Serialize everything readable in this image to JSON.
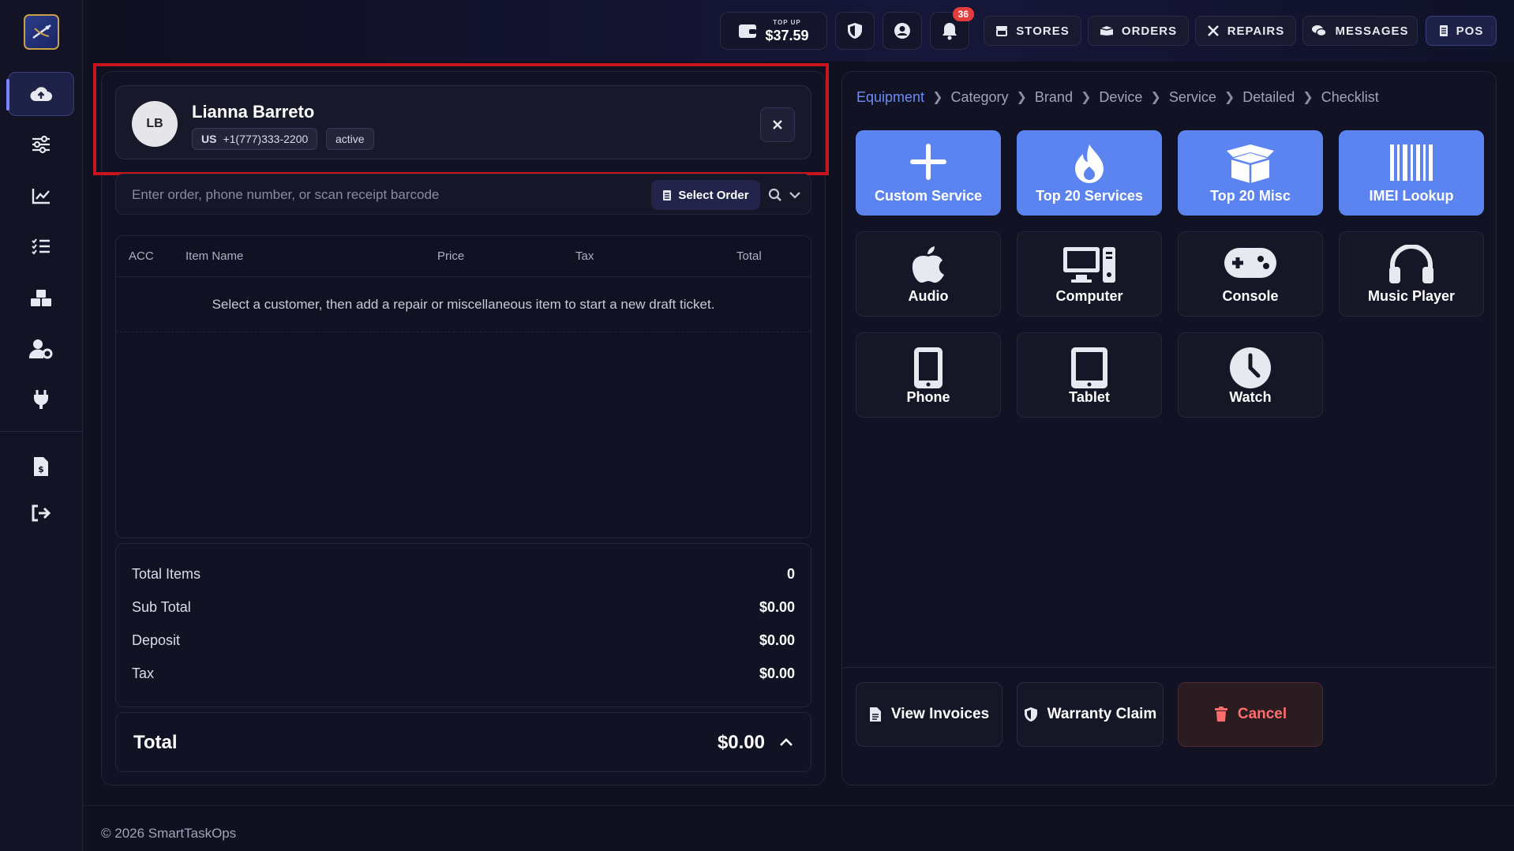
{
  "topbar": {
    "topup_label": "TOP UP",
    "balance": "$37.59",
    "notifications_count": "36",
    "nav": [
      {
        "label": "STORES",
        "icon": "store-icon"
      },
      {
        "label": "ORDERS",
        "icon": "orders-icon"
      },
      {
        "label": "REPAIRS",
        "icon": "repairs-icon"
      },
      {
        "label": "MESSAGES",
        "icon": "messages-icon"
      },
      {
        "label": "POS",
        "icon": "pos-icon",
        "active": true
      }
    ]
  },
  "sidebar": {
    "items": [
      {
        "icon": "cloud-upload-icon",
        "active": true
      },
      {
        "icon": "sliders-icon"
      },
      {
        "icon": "chart-line-icon"
      },
      {
        "icon": "checklist-icon"
      },
      {
        "icon": "boxes-icon"
      },
      {
        "icon": "user-gear-icon"
      },
      {
        "icon": "plug-icon"
      },
      {
        "icon": "invoice-dollar-icon"
      },
      {
        "icon": "logout-icon"
      }
    ]
  },
  "customer": {
    "initials": "LB",
    "name": "Lianna Barreto",
    "country": "US",
    "phone": "+1(777)333-2200",
    "status": "active"
  },
  "search": {
    "placeholder": "Enter order, phone number, or scan receipt barcode",
    "select_order_label": "Select Order"
  },
  "table": {
    "columns": [
      "ACC",
      "Item Name",
      "Price",
      "Tax",
      "Total"
    ],
    "empty_message": "Select a customer, then add a repair or miscellaneous item to start a new draft ticket."
  },
  "totals": {
    "rows": [
      {
        "label": "Total Items",
        "value": "0"
      },
      {
        "label": "Sub Total",
        "value": "$0.00"
      },
      {
        "label": "Deposit",
        "value": "$0.00"
      },
      {
        "label": "Tax",
        "value": "$0.00"
      }
    ],
    "grand_label": "Total",
    "grand_value": "$0.00"
  },
  "breadcrumbs": [
    "Equipment",
    "Category",
    "Brand",
    "Device",
    "Service",
    "Detailed",
    "Checklist"
  ],
  "tiles": [
    {
      "label": "Custom Service",
      "icon": "plus-icon",
      "style": "blue"
    },
    {
      "label": "Top 20 Services",
      "icon": "fire-icon",
      "style": "blue"
    },
    {
      "label": "Top 20 Misc",
      "icon": "box-open-icon",
      "style": "blue"
    },
    {
      "label": "IMEI Lookup",
      "icon": "barcode-icon",
      "style": "blue"
    },
    {
      "label": "Audio",
      "icon": "apple-icon",
      "style": "dark"
    },
    {
      "label": "Computer",
      "icon": "desktop-icon",
      "style": "dark"
    },
    {
      "label": "Console",
      "icon": "gamepad-icon",
      "style": "dark"
    },
    {
      "label": "Music Player",
      "icon": "headphones-icon",
      "style": "dark"
    },
    {
      "label": "Phone",
      "icon": "phone-icon",
      "style": "dark"
    },
    {
      "label": "Tablet",
      "icon": "tablet-icon",
      "style": "dark"
    },
    {
      "label": "Watch",
      "icon": "clock-icon",
      "style": "dark"
    }
  ],
  "actions": {
    "view_invoices": "View Invoices",
    "warranty_claim": "Warranty Claim",
    "cancel": "Cancel"
  },
  "footer": {
    "copyright": "© 2026 SmartTaskOps"
  },
  "colors": {
    "accent_blue": "#5b84f0",
    "breadcrumb_active": "#6d8cf5",
    "highlight_red": "#c8141c",
    "cancel_red": "#ff6d6d",
    "badge_red": "#e53b3b"
  }
}
